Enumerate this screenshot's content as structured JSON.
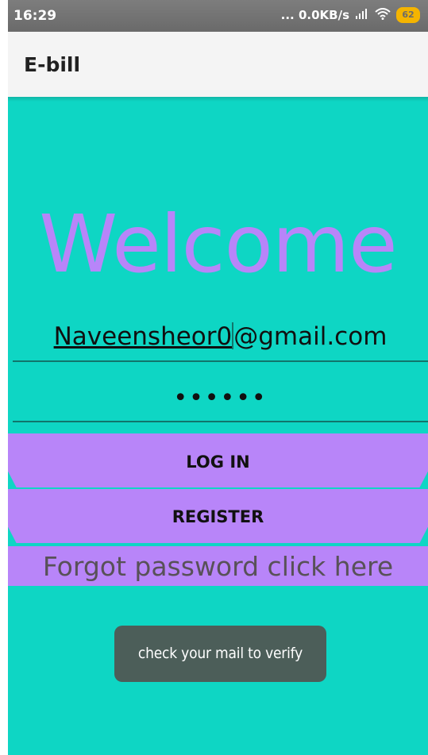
{
  "status_bar": {
    "time": "16:29",
    "network_speed": "... 0.0KB/s",
    "signal_icon": "signal-bars-icon",
    "wifi_icon": "wifi-icon",
    "battery_level": "62"
  },
  "app_bar": {
    "title": "E-bill"
  },
  "login": {
    "welcome": "Welcome",
    "email_prefix": "Naveensheor0",
    "email_suffix": "@gmail.com",
    "password_mask": "••••••",
    "login_label": "LOG IN",
    "register_label": "REGISTER",
    "forgot_label": "Forgot password click here"
  },
  "toast": {
    "message": "check your mail to verify"
  },
  "colors": {
    "background": "#0ed6c4",
    "accent": "#b885f9",
    "app_bar": "#f4f4f4",
    "toast": "#4c5e59"
  }
}
